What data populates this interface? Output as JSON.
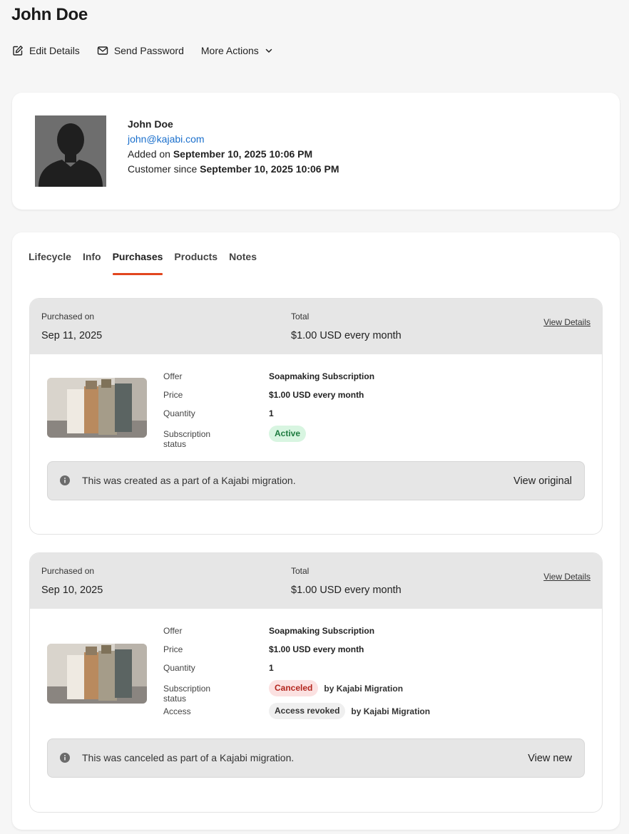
{
  "header": {
    "title": "John Doe"
  },
  "actions": {
    "edit_label": "Edit Details",
    "send_password_label": "Send Password",
    "more_actions_label": "More Actions"
  },
  "profile": {
    "name": "John Doe",
    "email": "john@kajabi.com",
    "added_prefix": "Added on ",
    "added_date": "September 10, 2025 10:06 PM",
    "since_prefix": "Customer since ",
    "since_date": "September 10, 2025 10:06 PM"
  },
  "tabs": [
    {
      "label": "Lifecycle"
    },
    {
      "label": "Info"
    },
    {
      "label": "Purchases"
    },
    {
      "label": "Products"
    },
    {
      "label": "Notes"
    }
  ],
  "active_tab": "Purchases",
  "purchases": [
    {
      "purchased_on_label": "Purchased on",
      "purchased_on": "Sep 11, 2025",
      "total_label": "Total",
      "total": "$1.00 USD every month",
      "view_details": "View Details",
      "offer_label": "Offer",
      "offer": "Soapmaking Subscription",
      "price_label": "Price",
      "price": "$1.00 USD every month",
      "quantity_label": "Quantity",
      "quantity": "1",
      "status_label": "Subscription status",
      "status": "Active",
      "status_color": "#d8f5e1",
      "notice": "This was created as a part of a Kajabi migration.",
      "notice_action": "View original"
    },
    {
      "purchased_on_label": "Purchased on",
      "purchased_on": "Sep 10, 2025",
      "total_label": "Total",
      "total": "$1.00 USD every month",
      "view_details": "View Details",
      "offer_label": "Offer",
      "offer": "Soapmaking Subscription",
      "price_label": "Price",
      "price": "$1.00 USD every month",
      "quantity_label": "Quantity",
      "quantity": "1",
      "status_label": "Subscription status",
      "status": "Canceled",
      "status_color": "#fbe1e1",
      "status_by": "by Kajabi Migration",
      "access_label": "Access",
      "access": "Access revoked",
      "access_by": "by Kajabi Migration",
      "notice": "This was canceled as part of a Kajabi migration.",
      "notice_action": "View new"
    }
  ],
  "colors": {
    "accent": "#e2461f",
    "link": "#1a6fcc"
  }
}
